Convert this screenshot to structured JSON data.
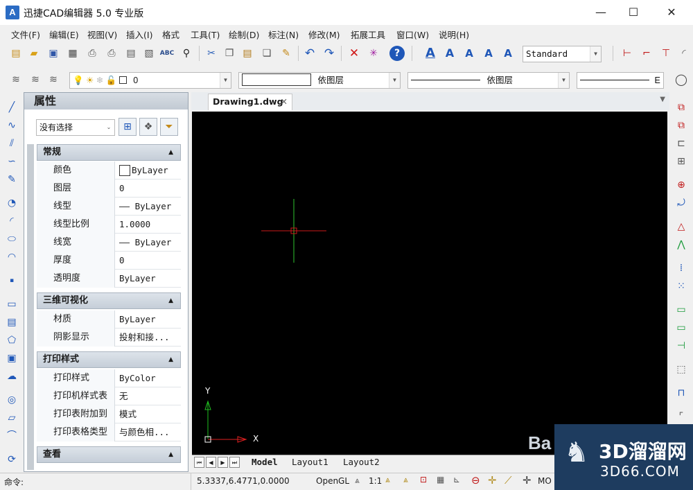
{
  "window": {
    "title": "迅捷CAD编辑器 5.0 专业版",
    "app_icon_text": "A",
    "minimize": "—",
    "maximize": "☐",
    "close": "✕"
  },
  "menu": [
    "文件(F)",
    "编辑(E)",
    "视图(V)",
    "插入(I)",
    "格式",
    "工具(T)",
    "绘制(D)",
    "标注(N)",
    "修改(M)",
    "拓展工具",
    "窗口(W)",
    "说明(H)"
  ],
  "toolbar": {
    "text_style": "Standard",
    "layer_value": "0",
    "color_value": "",
    "linetype_label": "依图层",
    "lineweight_label": "依图层",
    "lineweight_tail": "E"
  },
  "properties": {
    "title": "属性",
    "selection": "没有选择",
    "sections": [
      {
        "name": "常规",
        "rows": [
          {
            "name": "颜色",
            "value": "ByLayer"
          },
          {
            "name": "图层",
            "value": "0"
          },
          {
            "name": "线型",
            "value": "—— ByLayer"
          },
          {
            "name": "线型比例",
            "value": "1.0000"
          },
          {
            "name": "线宽",
            "value": "—— ByLayer"
          },
          {
            "name": "厚度",
            "value": "0"
          },
          {
            "name": "透明度",
            "value": "ByLayer"
          }
        ]
      },
      {
        "name": "三维可视化",
        "rows": [
          {
            "name": "材质",
            "value": "ByLayer"
          },
          {
            "name": "阴影显示",
            "value": "投射和接..."
          }
        ]
      },
      {
        "name": "打印样式",
        "rows": [
          {
            "name": "打印样式",
            "value": "ByColor"
          },
          {
            "name": "打印机样式表",
            "value": "无"
          },
          {
            "name": "打印表附加到",
            "value": "模式"
          },
          {
            "name": "打印表格类型",
            "value": "与颜色相..."
          }
        ]
      },
      {
        "name": "查看",
        "rows": []
      }
    ]
  },
  "document": {
    "tab": "Drawing1.dwg",
    "tab_close": "✕"
  },
  "canvas": {
    "axis_x": "X",
    "axis_y": "Y"
  },
  "layouts": [
    "Model",
    "Layout1",
    "Layout2"
  ],
  "status": {
    "command_label": "命令:",
    "coordinates": "5.3337,6.4771,0.0000",
    "render": "OpenGL",
    "scale": "1:1",
    "mode_tail": "MO"
  },
  "watermark": {
    "main": "3D溜溜网",
    "url": "3D66.COM",
    "baidu": "Ba"
  },
  "colors": {
    "canvas": "#000000",
    "crosshair_v": "#2ec52e",
    "crosshair_h": "#cc1a1a",
    "ucs_x": "#e02020",
    "ucs_y": "#20c020",
    "watermark_bg": "#1e3c5f"
  }
}
